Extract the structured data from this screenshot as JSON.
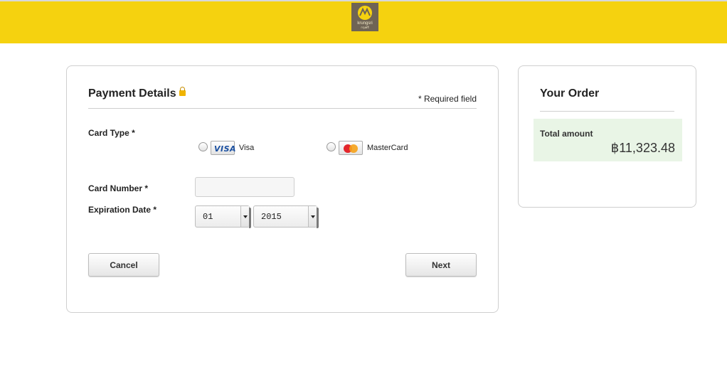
{
  "brand": {
    "logo_name": "krungsri",
    "logo_sub": "กรุงศรี",
    "accent": "#f5d20f"
  },
  "payment": {
    "title": "Payment Details",
    "required_note": "* Required field",
    "card_type_label": "Card Type *",
    "options": [
      {
        "logo": "VISA",
        "label": "Visa"
      },
      {
        "logo": "mastercard",
        "label": "MasterCard"
      }
    ],
    "card_number_label": "Card Number *",
    "card_number_value": "",
    "expiration_label": "Expiration Date *",
    "exp_month": "01",
    "exp_year": "2015",
    "cancel_label": "Cancel",
    "next_label": "Next"
  },
  "order": {
    "title": "Your Order",
    "total_label": "Total amount",
    "total_amount": "฿11,323.48"
  }
}
